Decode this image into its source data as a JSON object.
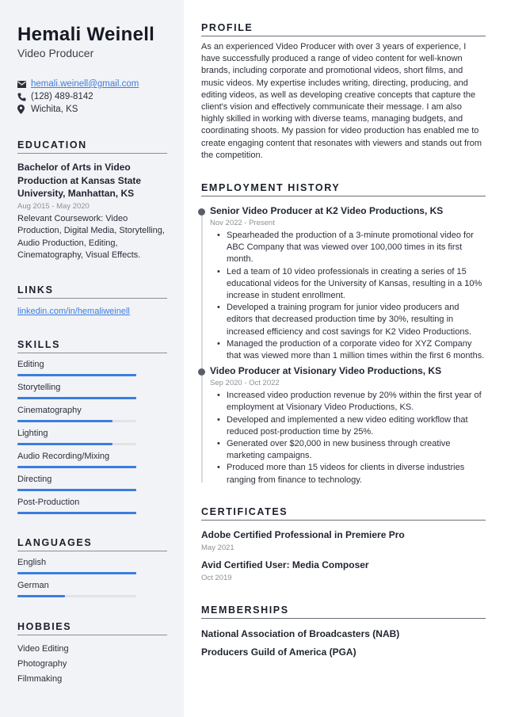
{
  "header": {
    "name": "Hemali Weinell",
    "title": "Video Producer"
  },
  "contact": {
    "email": "hemali.weinell@gmail.com",
    "phone": "(128) 489-8142",
    "location": "Wichita, KS"
  },
  "education": {
    "heading": "EDUCATION",
    "degree": "Bachelor of Arts in Video Production at Kansas State University, Manhattan, KS",
    "dates": "Aug 2015 - May 2020",
    "coursework": "Relevant Coursework: Video Production, Digital Media, Storytelling, Audio Production, Editing, Cinematography, Visual Effects."
  },
  "links": {
    "heading": "LINKS",
    "items": [
      "linkedin.com/in/hemaliweinell"
    ]
  },
  "skills": {
    "heading": "SKILLS",
    "items": [
      {
        "label": "Editing",
        "level": 100
      },
      {
        "label": "Storytelling",
        "level": 100
      },
      {
        "label": "Cinematography",
        "level": 80
      },
      {
        "label": "Lighting",
        "level": 80
      },
      {
        "label": "Audio Recording/Mixing",
        "level": 100
      },
      {
        "label": "Directing",
        "level": 100
      },
      {
        "label": "Post-Production",
        "level": 100
      }
    ]
  },
  "languages": {
    "heading": "LANGUAGES",
    "items": [
      {
        "label": "English",
        "level": 100
      },
      {
        "label": "German",
        "level": 40
      }
    ]
  },
  "hobbies": {
    "heading": "HOBBIES",
    "items": [
      "Video Editing",
      "Photography",
      "Filmmaking"
    ]
  },
  "profile": {
    "heading": "PROFILE",
    "text": "As an experienced Video Producer with over 3 years of experience, I have successfully produced a range of video content for well-known brands, including corporate and promotional videos, short films, and music videos. My expertise includes writing, directing, producing, and editing videos, as well as developing creative concepts that capture the client's vision and effectively communicate their message. I am also highly skilled in working with diverse teams, managing budgets, and coordinating shoots. My passion for video production has enabled me to create engaging content that resonates with viewers and stands out from the competition."
  },
  "employment": {
    "heading": "EMPLOYMENT HISTORY",
    "jobs": [
      {
        "title": "Senior Video Producer at K2 Video Productions, KS",
        "dates": "Nov 2022 - Present",
        "bullets": [
          "Spearheaded the production of a 3-minute promotional video for ABC Company that was viewed over 100,000 times in its first month.",
          "Led a team of 10 video professionals in creating a series of 15 educational videos for the University of Kansas, resulting in a 10% increase in student enrollment.",
          "Developed a training program for junior video producers and editors that decreased production time by 30%, resulting in increased efficiency and cost savings for K2 Video Productions.",
          "Managed the production of a corporate video for XYZ Company that was viewed more than 1 million times within the first 6 months."
        ]
      },
      {
        "title": "Video Producer at Visionary Video Productions, KS",
        "dates": "Sep 2020 - Oct 2022",
        "bullets": [
          "Increased video production revenue by 20% within the first year of employment at Visionary Video Productions, KS.",
          "Developed and implemented a new video editing workflow that reduced post-production time by 25%.",
          "Generated over $20,000 in new business through creative marketing campaigns.",
          "Produced more than 15 videos for clients in diverse industries ranging from finance to technology."
        ]
      }
    ]
  },
  "certificates": {
    "heading": "CERTIFICATES",
    "items": [
      {
        "title": "Adobe Certified Professional in Premiere Pro",
        "date": "May 2021"
      },
      {
        "title": "Avid Certified User: Media Composer",
        "date": "Oct 2019"
      }
    ]
  },
  "memberships": {
    "heading": "MEMBERSHIPS",
    "items": [
      "National Association of Broadcasters (NAB)",
      "Producers Guild of America (PGA)"
    ]
  },
  "colors": {
    "accent": "#3b7de0",
    "sidebar_bg": "#f2f3f6",
    "text": "#1f2430",
    "muted": "#8b8f97"
  }
}
